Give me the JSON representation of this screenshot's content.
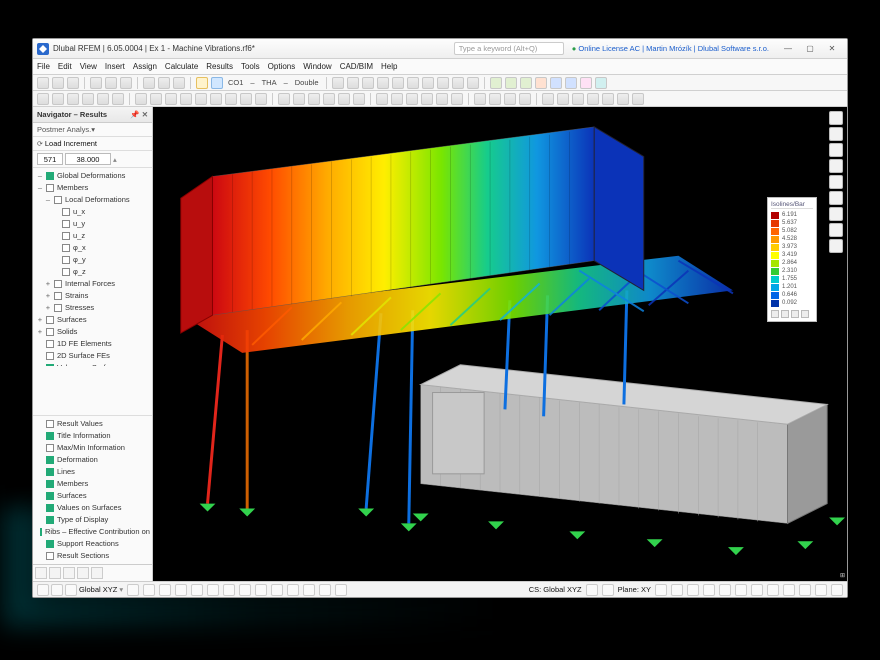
{
  "titlebar": {
    "title": "Dlubal RFEM | 6.05.0004 | Ex 1 - Machine Vibrations.rf6*",
    "search_placeholder": "Type a keyword (Alt+Q)",
    "license": "Online License AC | Martin Mrózík | Dlubal Software s.r.o.",
    "minimize": "—",
    "maximize": "▢",
    "close": "✕"
  },
  "menubar": [
    "File",
    "Edit",
    "View",
    "Insert",
    "Assign",
    "Calculate",
    "Results",
    "Tools",
    "Options",
    "Window",
    "CAD/BIM",
    "Help"
  ],
  "toolbar2": {
    "combo1": "CO1",
    "combo2": "THA",
    "combo3": "Double"
  },
  "navigator": {
    "title": "Navigator – Results",
    "tab": "Postmer Analys.",
    "load_increment_label": "Load Increment",
    "spin": "571",
    "value": "38.000"
  },
  "tree_upper": [
    {
      "d": 0,
      "chk": "on",
      "tw": "–",
      "label": "Global Deformations"
    },
    {
      "d": 0,
      "chk": "off",
      "tw": "–",
      "label": "Members"
    },
    {
      "d": 1,
      "chk": "off",
      "tw": "–",
      "label": "Local Deformations"
    },
    {
      "d": 2,
      "chk": "off",
      "tw": "",
      "label": "u_x"
    },
    {
      "d": 2,
      "chk": "off",
      "tw": "",
      "label": "u_y"
    },
    {
      "d": 2,
      "chk": "off",
      "tw": "",
      "label": "u_z"
    },
    {
      "d": 2,
      "chk": "off",
      "tw": "",
      "label": "φ_x"
    },
    {
      "d": 2,
      "chk": "off",
      "tw": "",
      "label": "φ_y"
    },
    {
      "d": 2,
      "chk": "off",
      "tw": "",
      "label": "φ_z"
    },
    {
      "d": 1,
      "chk": "off",
      "tw": "+",
      "label": "Internal Forces"
    },
    {
      "d": 1,
      "chk": "off",
      "tw": "+",
      "label": "Strains"
    },
    {
      "d": 1,
      "chk": "off",
      "tw": "+",
      "label": "Stresses"
    },
    {
      "d": 0,
      "chk": "off",
      "tw": "+",
      "label": "Surfaces"
    },
    {
      "d": 0,
      "chk": "off",
      "tw": "+",
      "label": "Solids"
    },
    {
      "d": 0,
      "chk": "off",
      "tw": "",
      "label": "1D FE Elements"
    },
    {
      "d": 0,
      "chk": "off",
      "tw": "",
      "label": "2D Surface FEs"
    },
    {
      "d": 0,
      "chk": "on",
      "tw": "",
      "label": "Values on Surfaces"
    }
  ],
  "tree_lower": [
    {
      "d": 0,
      "chk": "off",
      "label": "Result Values"
    },
    {
      "d": 0,
      "chk": "on",
      "label": "Title Information"
    },
    {
      "d": 0,
      "chk": "off",
      "label": "Max/Min Information"
    },
    {
      "d": 0,
      "chk": "on",
      "label": "Deformation"
    },
    {
      "d": 0,
      "chk": "on",
      "label": "Lines"
    },
    {
      "d": 0,
      "chk": "on",
      "label": "Members"
    },
    {
      "d": 0,
      "chk": "on",
      "label": "Surfaces"
    },
    {
      "d": 0,
      "chk": "on",
      "label": "Values on Surfaces"
    },
    {
      "d": 0,
      "chk": "on",
      "label": "Type of Display"
    },
    {
      "d": 0,
      "chk": "on",
      "label": "Ribs – Effective Contribution on Surface/Mem…"
    },
    {
      "d": 0,
      "chk": "on",
      "label": "Support Reactions"
    },
    {
      "d": 0,
      "chk": "off",
      "label": "Result Sections"
    }
  ],
  "legend": {
    "title": "Isolines/Bar",
    "rows": [
      {
        "c": "#b30000",
        "v": "6.191"
      },
      {
        "c": "#e63900",
        "v": "5.637"
      },
      {
        "c": "#ff6600",
        "v": "5.082"
      },
      {
        "c": "#ff9900",
        "v": "4.528"
      },
      {
        "c": "#ffcc00",
        "v": "3.973"
      },
      {
        "c": "#ffff00",
        "v": "3.419"
      },
      {
        "c": "#a6e600",
        "v": "2.864"
      },
      {
        "c": "#33cc33",
        "v": "2.310"
      },
      {
        "c": "#00cccc",
        "v": "1.755"
      },
      {
        "c": "#00a6e6",
        "v": "1.201"
      },
      {
        "c": "#0066e6",
        "v": "0.646"
      },
      {
        "c": "#0033aa",
        "v": "0.092"
      }
    ]
  },
  "status": {
    "left": "Global XYZ",
    "mid_label": "CS: Global XYZ",
    "plane": "Plane: XY"
  }
}
